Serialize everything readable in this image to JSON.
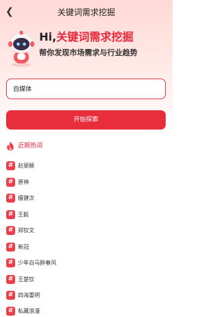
{
  "header": {
    "back_icon": "chevron-left-icon",
    "title": "关键词需求挖掘"
  },
  "hero": {
    "prefix": "Hi,",
    "highlight": "关键词需求挖掘",
    "subtitle": "帮你发现市场需求与行业趋势",
    "mascot_icon": "robot-mascot"
  },
  "search": {
    "value": "自媒体",
    "placeholder": ""
  },
  "start_button": {
    "label": "开始探索"
  },
  "hot": {
    "icon": "flame-icon",
    "title": "近期热词",
    "items": [
      "赵丽颖",
      "原神",
      "檀健次",
      "王毅",
      "郑钦文",
      "新冠",
      "少年白马醉春风",
      "王楚钦",
      "四海重明",
      "私藏浪漫"
    ]
  },
  "colors": {
    "accent": "#e8283b",
    "button": "#e82d3b",
    "hash_badge": "#ec3f4c"
  }
}
